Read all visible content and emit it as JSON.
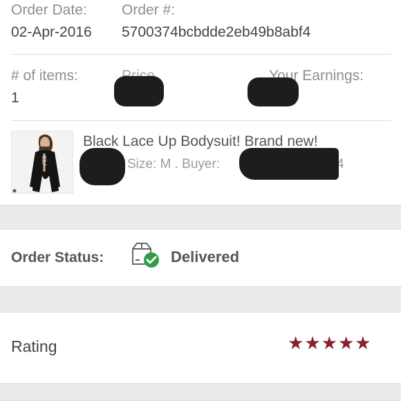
{
  "order": {
    "date_label": "Order Date:",
    "date_value": "02-Apr-2016",
    "number_label": "Order #:",
    "number_value": "5700374bcbdde2eb49b8abf4"
  },
  "summary": {
    "items_label": "# of items:",
    "items_value": "1",
    "price_label": "Price",
    "earnings_label": "Your Earnings:"
  },
  "product": {
    "title": "Black Lace Up Bodysuit! Brand new!",
    "meta": "Size: M . Buyer:",
    "meta_tail": "4"
  },
  "status": {
    "label": "Order Status:",
    "value": "Delivered",
    "icon": "package-delivered-icon",
    "check_color": "#2e9e47"
  },
  "rating": {
    "label": "Rating",
    "stars": 5,
    "max": 5,
    "star_color": "#8b1f30"
  },
  "colors": {
    "separator": "#ecebe9",
    "redaction": "#1d1d1d"
  }
}
